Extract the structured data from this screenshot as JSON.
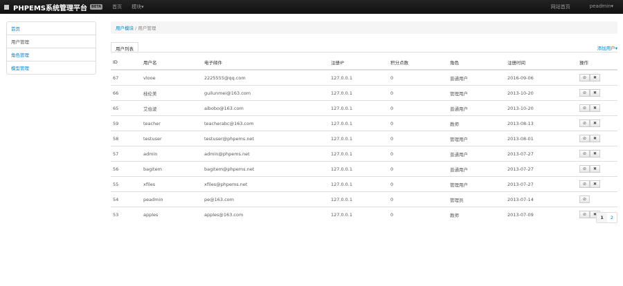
{
  "nav": {
    "brand": "PHPEMS系统管理平台",
    "beta": "BETA",
    "home": "首页",
    "modules": "模块▾",
    "site_home": "网站首页",
    "user": "peadmin▾"
  },
  "sidebar": [
    "首页",
    "用户管理",
    "角色管理",
    "模型管理"
  ],
  "breadcrumb": {
    "parent": "用户模块",
    "current": "用户管理"
  },
  "tab": "用户列表",
  "add_user": "添加用户▾",
  "headers": [
    "ID",
    "用户名",
    "电子邮件",
    "注册IP",
    "积分点数",
    "角色",
    "注册时间",
    "操作"
  ],
  "rows": [
    [
      "67",
      "vlooe",
      "2225555@qq.com",
      "127.0.0.1",
      "0",
      "普通用户",
      "2016-09-06"
    ],
    [
      "66",
      "桂伦美",
      "guilunmei@163.com",
      "127.0.0.1",
      "0",
      "管理用户",
      "2013-10-20"
    ],
    [
      "65",
      "艾伯波",
      "aibobo@163.com",
      "127.0.0.1",
      "0",
      "普通用户",
      "2013-10-20"
    ],
    [
      "59",
      "teacher",
      "teacherabc@163.com",
      "127.0.0.1",
      "0",
      "教师",
      "2013-08-13"
    ],
    [
      "58",
      "testuser",
      "testuser@phpems.net",
      "127.0.0.1",
      "0",
      "管理用户",
      "2013-08-01"
    ],
    [
      "57",
      "admin",
      "admin@phpems.net",
      "127.0.0.1",
      "0",
      "普通用户",
      "2013-07-27"
    ],
    [
      "56",
      "bagitem",
      "bagitem@phpems.net",
      "127.0.0.1",
      "0",
      "普通用户",
      "2013-07-27"
    ],
    [
      "55",
      "xfiles",
      "xfiles@phpems.net",
      "127.0.0.1",
      "0",
      "管理用户",
      "2013-07-27"
    ],
    [
      "54",
      "peadmin",
      "pe@163.com",
      "127.0.0.1",
      "0",
      "管理员",
      "2013-07-14"
    ],
    [
      "53",
      "apples",
      "apples@163.com",
      "127.0.0.1",
      "0",
      "教师",
      "2013-07-09"
    ]
  ],
  "pages": [
    "1",
    "2"
  ]
}
